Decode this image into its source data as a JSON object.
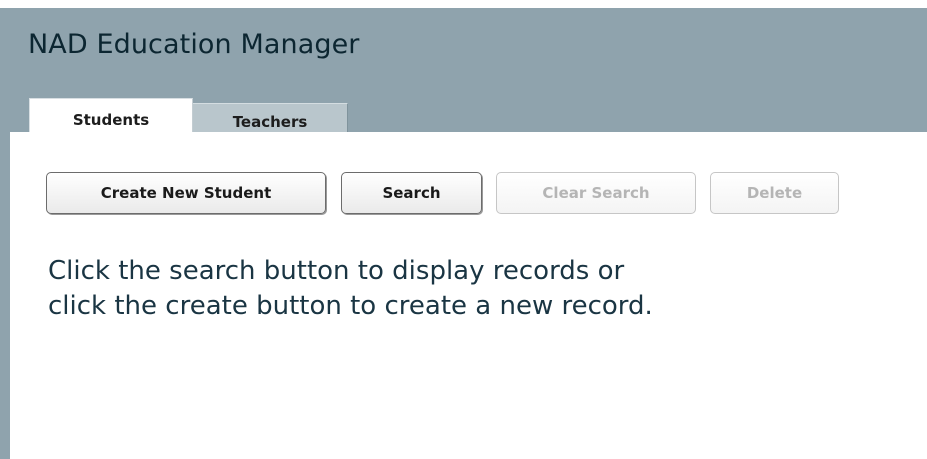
{
  "app": {
    "title": "NAD Education Manager"
  },
  "tabs": [
    {
      "label": "Students",
      "active": true
    },
    {
      "label": "Teachers",
      "active": false
    }
  ],
  "toolbar": {
    "create_label": "Create New Student",
    "search_label": "Search",
    "clear_search_label": "Clear Search",
    "delete_label": "Delete",
    "clear_search_enabled": false,
    "delete_enabled": false
  },
  "main": {
    "message": "Click the search button to display records or click the create button to create a new record."
  },
  "colors": {
    "header_bg": "#8fa3ad",
    "active_tab_bg": "#ffffff",
    "inactive_tab_bg": "#b9c6cc",
    "title_text": "#0c2631",
    "message_text": "#1a3543",
    "disabled_text": "#b5b5b5"
  }
}
